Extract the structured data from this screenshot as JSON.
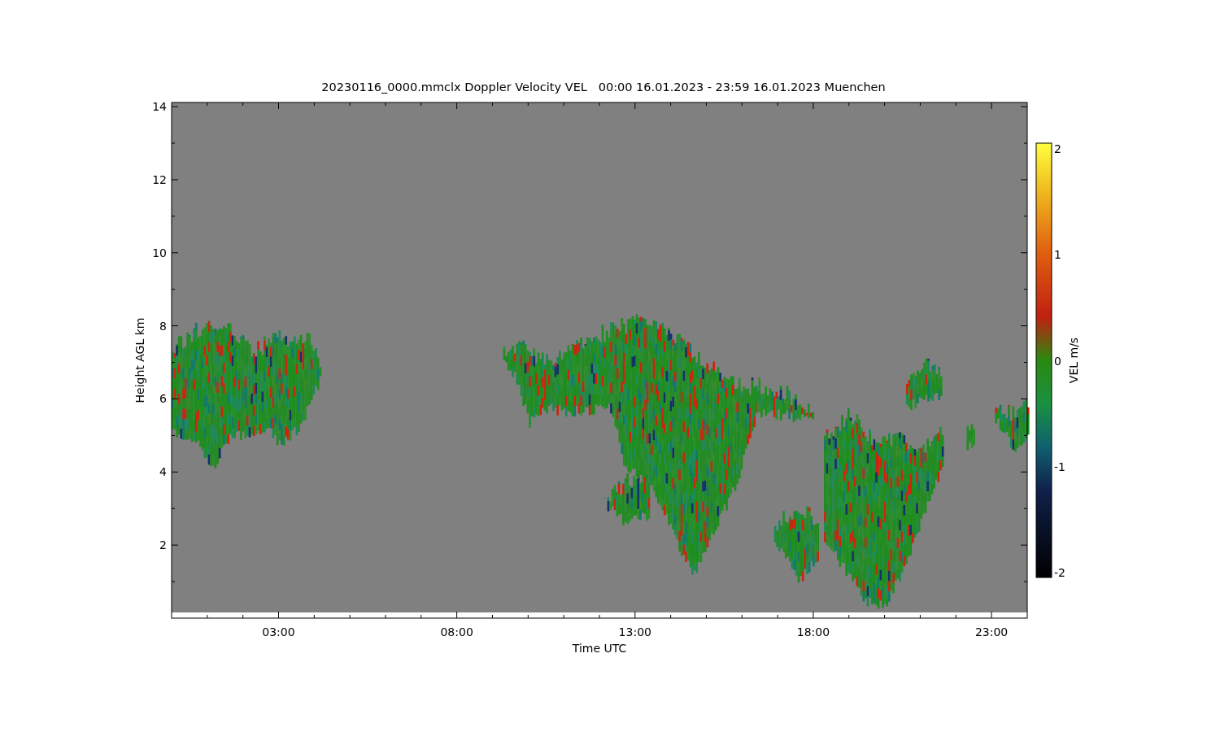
{
  "title": "20230116_0000.mmclx Doppler Velocity VEL   00:00 16.01.2023 - 23:59 16.01.2023 Muenchen",
  "y_axis": {
    "label": "Height AGL km",
    "ticks": [
      "14",
      "12",
      "10",
      "8",
      "6",
      "4",
      "2"
    ]
  },
  "x_axis": {
    "label": "Time UTC",
    "ticks": [
      "03:00",
      "08:00",
      "13:00",
      "18:00",
      "23:00"
    ]
  },
  "colorbar": {
    "label": "VEL m/s",
    "ticks": [
      "2",
      "1",
      "0",
      "-1",
      "-2"
    ]
  }
}
